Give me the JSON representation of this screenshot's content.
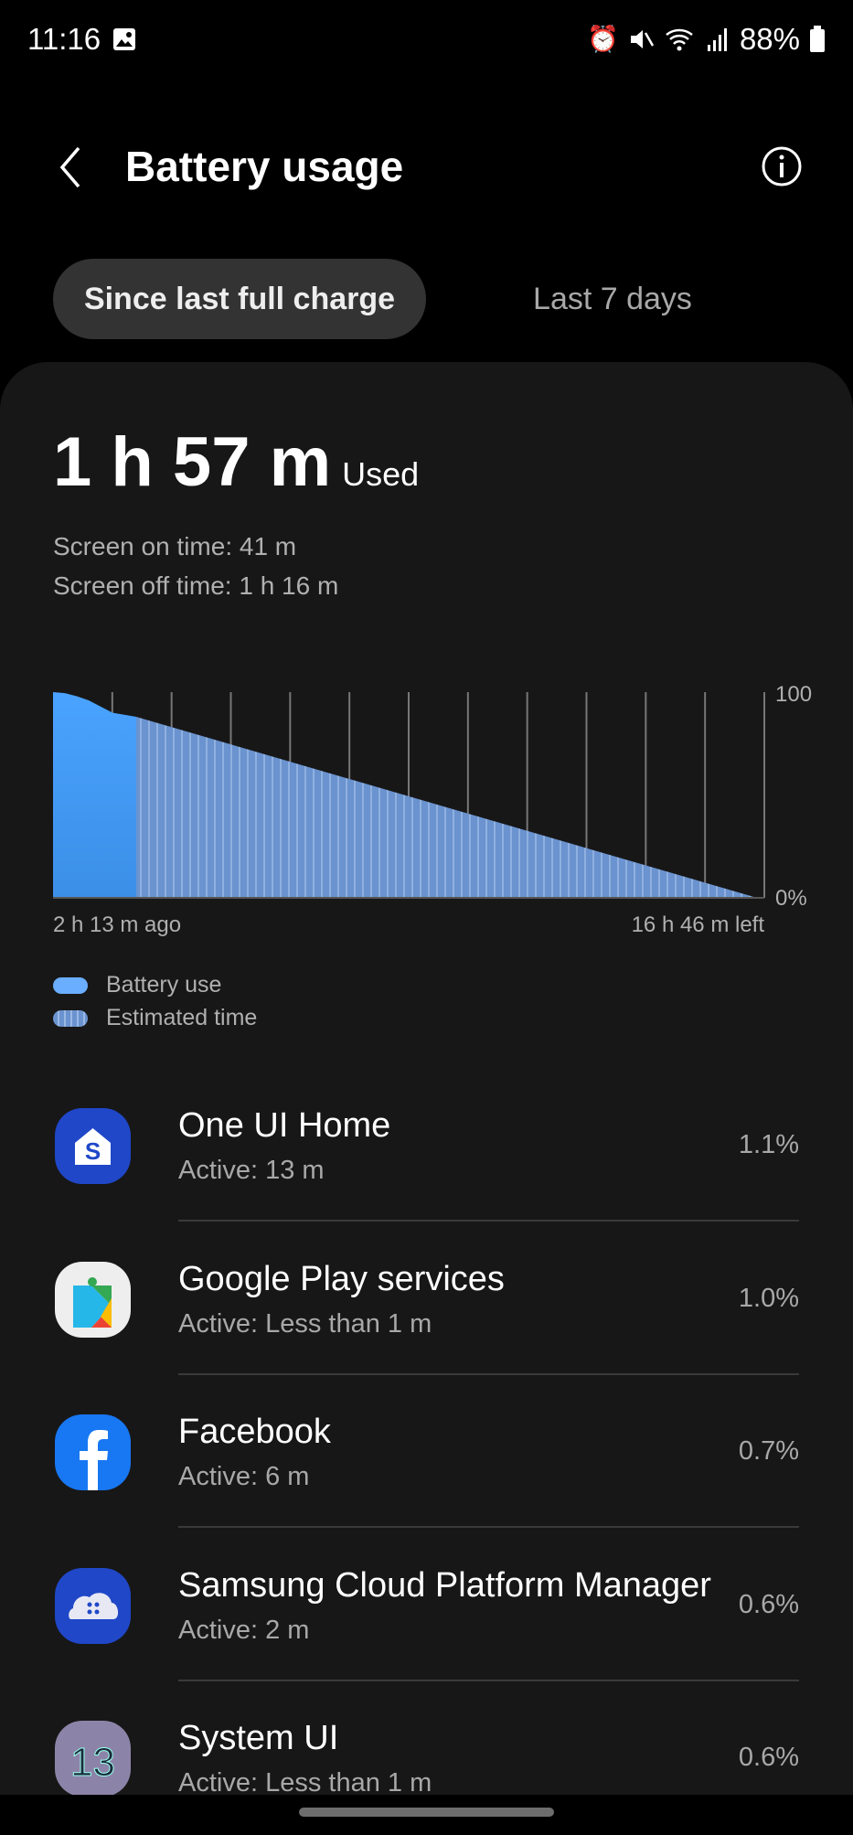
{
  "status_bar": {
    "time": "11:16",
    "battery": "88%",
    "icons": [
      "gallery-icon",
      "alarm-icon",
      "mute-icon",
      "wifi-icon",
      "signal-icon",
      "battery-icon"
    ]
  },
  "header": {
    "title": "Battery usage"
  },
  "tabs": [
    {
      "label": "Since last full charge",
      "selected": true
    },
    {
      "label": "Last 7 days",
      "selected": false
    }
  ],
  "summary": {
    "used_time": "1 h 57 m",
    "used_label": "Used",
    "screen_on": "Screen on time: 41 m",
    "screen_off": "Screen off time: 1 h 16 m"
  },
  "chart_data": {
    "type": "area",
    "y_ticks": [
      "100",
      "0%"
    ],
    "ylim": [
      0,
      100
    ],
    "x_start_label": "2 h 13 m ago",
    "x_end_label": "16 h 46 m left",
    "grid": "vertical",
    "legend": [
      {
        "name": "Battery use",
        "color": "#4a9ff5"
      },
      {
        "name": "Estimated time",
        "color": "#6a93cf"
      }
    ],
    "battery_use": [
      100,
      99.5,
      98,
      96,
      93,
      90,
      89,
      88
    ],
    "estimated_from": 88,
    "estimated_to": 0
  },
  "apps": [
    {
      "name": "One UI Home",
      "active": "Active: 13 m",
      "percent": "1.1%",
      "icon": "one-ui-home-icon"
    },
    {
      "name": "Google Play services",
      "active": "Active: Less than 1 m",
      "percent": "1.0%",
      "icon": "google-play-services-icon"
    },
    {
      "name": "Facebook",
      "active": "Active: 6 m",
      "percent": "0.7%",
      "icon": "facebook-icon"
    },
    {
      "name": "Samsung Cloud Platform Manager",
      "active": "Active: 2 m",
      "percent": "0.6%",
      "icon": "samsung-cloud-icon"
    },
    {
      "name": "System UI",
      "active": "Active: Less than 1 m",
      "percent": "0.6%",
      "icon": "system-ui-icon"
    }
  ]
}
